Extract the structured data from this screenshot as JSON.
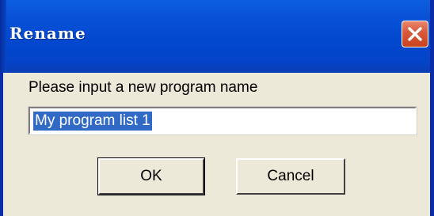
{
  "window": {
    "title": "Rename",
    "title_color": "#0248cf",
    "close_button_color": "#d7583a"
  },
  "dialog": {
    "prompt": "Please input a new program name",
    "name_value": "My program list 1",
    "ok_label": "OK",
    "cancel_label": "Cancel",
    "selection_color": "#316ac5"
  },
  "icons": {
    "close": "close-icon"
  }
}
